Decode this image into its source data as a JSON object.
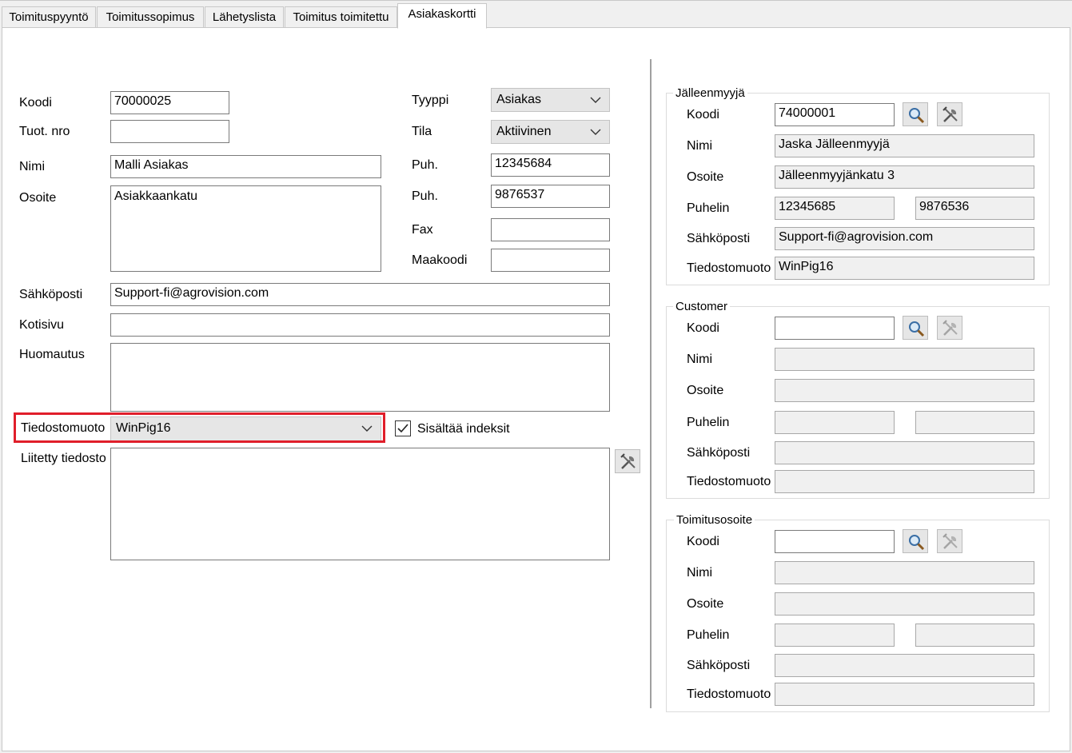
{
  "tabs": [
    {
      "label": "Toimituspyyntö"
    },
    {
      "label": "Toimitussopimus"
    },
    {
      "label": "Lähetyslista"
    },
    {
      "label": "Toimitus toimitettu"
    },
    {
      "label": "Asiakaskortti"
    }
  ],
  "active_tab": "Asiakaskortti",
  "form": {
    "koodi": {
      "label": "Koodi",
      "value": "70000025"
    },
    "tuot_nro": {
      "label": "Tuot. nro",
      "value": ""
    },
    "nimi": {
      "label": "Nimi",
      "value": "Malli Asiakas"
    },
    "osoite": {
      "label": "Osoite",
      "value": "Asiakkaankatu"
    },
    "tyyppi": {
      "label": "Tyyppi",
      "value": "Asiakas"
    },
    "tila": {
      "label": "Tila",
      "value": "Aktiivinen"
    },
    "puh1": {
      "label": "Puh.",
      "value": "12345684"
    },
    "puh2": {
      "label": "Puh.",
      "value": "9876537"
    },
    "fax": {
      "label": "Fax",
      "value": ""
    },
    "maakoodi": {
      "label": "Maakoodi",
      "value": ""
    },
    "sahkoposti": {
      "label": "Sähköposti",
      "value": "Support-fi@agrovision.com"
    },
    "kotisivu": {
      "label": "Kotisivu",
      "value": ""
    },
    "huomautus": {
      "label": "Huomautus",
      "value": ""
    },
    "tiedostomuoto": {
      "label": "Tiedostomuoto",
      "value": "WinPig16"
    },
    "sisaltaa_indeksit": {
      "label": "Sisältää indeksit",
      "checked": true
    },
    "liitetty_tiedosto": {
      "label": "Liitetty tiedosto",
      "value": ""
    }
  },
  "reseller": {
    "title": "Jälleenmyyjä",
    "koodi_label": "Koodi",
    "koodi": "74000001",
    "nimi_label": "Nimi",
    "nimi": "Jaska Jälleenmyyjä",
    "osoite_label": "Osoite",
    "osoite": "Jälleenmyyjänkatu 3",
    "puhelin_label": "Puhelin",
    "puhelin1": "12345685",
    "puhelin2": "9876536",
    "sahkoposti_label": "Sähköposti",
    "sahkoposti": "Support-fi@agrovision.com",
    "tiedostomuoto_label": "Tiedostomuoto",
    "tiedostomuoto": "WinPig16"
  },
  "customer": {
    "title": "Customer",
    "koodi_label": "Koodi",
    "koodi": "",
    "nimi_label": "Nimi",
    "nimi": "",
    "osoite_label": "Osoite",
    "osoite": "",
    "puhelin_label": "Puhelin",
    "puhelin1": "",
    "puhelin2": "",
    "sahkoposti_label": "Sähköposti",
    "sahkoposti": "",
    "tiedostomuoto_label": "Tiedostomuoto",
    "tiedostomuoto": ""
  },
  "delivery": {
    "title": "Toimitusosoite",
    "koodi_label": "Koodi",
    "koodi": "",
    "nimi_label": "Nimi",
    "nimi": "",
    "osoite_label": "Osoite",
    "osoite": "",
    "puhelin_label": "Puhelin",
    "puhelin1": "",
    "puhelin2": "",
    "sahkoposti_label": "Sähköposti",
    "sahkoposti": "",
    "tiedostomuoto_label": "Tiedostomuoto",
    "tiedostomuoto": ""
  },
  "icons": {
    "search": "magnifier-icon",
    "tools": "tools-icon",
    "dropdown": "chevron-down-icon",
    "check": "checkmark-icon"
  },
  "colors": {
    "highlight": "#e01e2a",
    "field_border": "#7a7a7a",
    "disabled_field": "#f0f0f0"
  }
}
